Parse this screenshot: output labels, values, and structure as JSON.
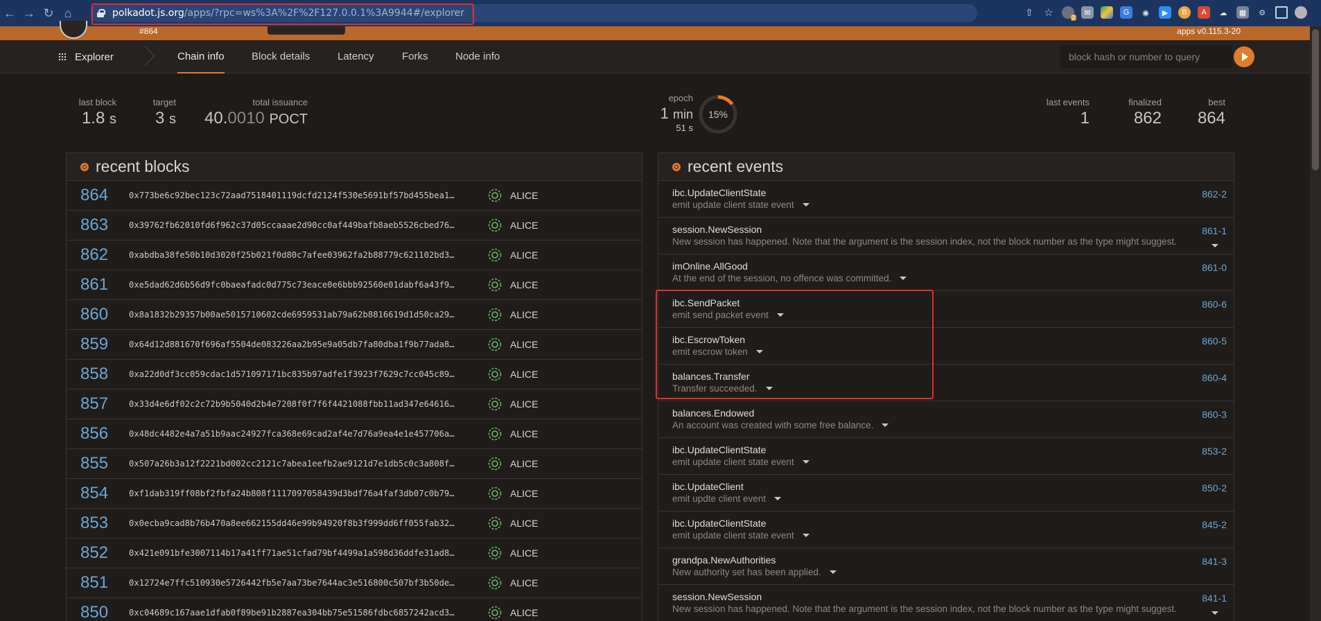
{
  "browser": {
    "url_host": "polkadot.js.org",
    "url_rest": "/apps/?rpc=ws%3A%2F%2F127.0.0.1%3A9944#/explorer",
    "ext_badge": "2"
  },
  "appbar": {
    "block_label": "#864",
    "version": "apps v0.115.3-20"
  },
  "tabs": {
    "root": "Explorer",
    "items": [
      "Chain info",
      "Block details",
      "Latency",
      "Forks",
      "Node info"
    ],
    "query_placeholder": "block hash or number to query"
  },
  "summary": {
    "last_block_label": "last block",
    "last_block_value": "1.8",
    "last_block_unit": "s",
    "target_label": "target",
    "target_value": "3",
    "target_unit": "s",
    "issuance_label": "total issuance",
    "issuance_int": "40.",
    "issuance_frac": "0010",
    "issuance_unit": "POCT",
    "epoch_label": "epoch",
    "epoch_min": "1",
    "epoch_min_unit": "min",
    "epoch_sec": "51",
    "epoch_sec_unit": "s",
    "epoch_percent": "15%",
    "epoch_progress": 0.15,
    "last_events_label": "last events",
    "last_events_value": "1",
    "finalized_label": "finalized",
    "finalized_value": "862",
    "best_label": "best",
    "best_value": "864"
  },
  "recent_blocks": {
    "title": "recent blocks",
    "rows": [
      {
        "num": "864",
        "hash": "0x773be6c92bec123c72aad7518401119dcfd2124f530e5691bf57bd455bea1…",
        "author": "ALICE"
      },
      {
        "num": "863",
        "hash": "0x39762fb62010fd6f962c37d05ccaaae2d90cc0af449bafb8aeb5526cbed76…",
        "author": "ALICE"
      },
      {
        "num": "862",
        "hash": "0xabdba38fe50b10d3020f25b021f0d80c7afee03962fa2b88779c621102bd3…",
        "author": "ALICE"
      },
      {
        "num": "861",
        "hash": "0xe5dad62d6b56d9fc0baeafadc0d775c73eace0e6bbb92560e01dabf6a43f9…",
        "author": "ALICE"
      },
      {
        "num": "860",
        "hash": "0x8a1832b29357b00ae5015710602cde6959531ab79a62b8816619d1d50ca29…",
        "author": "ALICE"
      },
      {
        "num": "859",
        "hash": "0x64d12d881670f696af5504de083226aa2b95e9a05db7fa80dba1f9b77ada8…",
        "author": "ALICE"
      },
      {
        "num": "858",
        "hash": "0xa22d0df3cc059cdac1d571097171bc835b97adfe1f3923f7629c7cc045c89…",
        "author": "ALICE"
      },
      {
        "num": "857",
        "hash": "0x33d4e6df02c2c72b9b5040d2b4e7208f0f7f6f4421088fbb11ad347e64616…",
        "author": "ALICE"
      },
      {
        "num": "856",
        "hash": "0x48dc4482e4a7a51b9aac24927fca368e69cad2af4e7d76a9ea4e1e457706a…",
        "author": "ALICE"
      },
      {
        "num": "855",
        "hash": "0x507a26b3a12f2221bd002cc2121c7abea1eefb2ae9121d7e1db5c0c3a808f…",
        "author": "ALICE"
      },
      {
        "num": "854",
        "hash": "0xf1dab319ff08bf2fbfa24b808f1117097058439d3bdf76a4faf3db07c0b79…",
        "author": "ALICE"
      },
      {
        "num": "853",
        "hash": "0x0ecba9cad8b76b470a8ee662155dd46e99b94920f8b3f999dd6ff055fab32…",
        "author": "ALICE"
      },
      {
        "num": "852",
        "hash": "0x421e091bfe3007114b17a41ff71ae51cfad79bf4499a1a598d36ddfe31ad8…",
        "author": "ALICE"
      },
      {
        "num": "851",
        "hash": "0x12724e7ffc510930e5726442fb5e7aa73be7644ac3e516800c507bf3b50de…",
        "author": "ALICE"
      },
      {
        "num": "850",
        "hash": "0xc04689c167aae1dfab0f89be91b2887ea304bb75e51586fdbc6857242acd3…",
        "author": "ALICE"
      }
    ]
  },
  "recent_events": {
    "title": "recent events",
    "rows": [
      {
        "name": "ibc.UpdateClientState",
        "desc": "emit update client state event",
        "id": "862-2"
      },
      {
        "name": "session.NewSession",
        "desc": "New session has happened. Note that the argument is the session index, not the block number as the type might suggest.",
        "id": "861-1"
      },
      {
        "name": "imOnline.AllGood",
        "desc": "At the end of the session, no offence was committed.",
        "id": "861-0"
      },
      {
        "name": "ibc.SendPacket",
        "desc": "emit send packet event",
        "id": "860-6"
      },
      {
        "name": "ibc.EscrowToken",
        "desc": "emit escrow token",
        "id": "860-5"
      },
      {
        "name": "balances.Transfer",
        "desc": "Transfer succeeded.",
        "id": "860-4"
      },
      {
        "name": "balances.Endowed",
        "desc": "An account was created with some free balance.",
        "id": "860-3"
      },
      {
        "name": "ibc.UpdateClientState",
        "desc": "emit update client state event",
        "id": "853-2"
      },
      {
        "name": "ibc.UpdateClient",
        "desc": "emit updte client event",
        "id": "850-2"
      },
      {
        "name": "ibc.UpdateClientState",
        "desc": "emit update client state event",
        "id": "845-2"
      },
      {
        "name": "grandpa.NewAuthorities",
        "desc": "New authority set has been applied.",
        "id": "841-3"
      },
      {
        "name": "session.NewSession",
        "desc": "New session has happened. Note that the argument is the session index, not the block number as the type might suggest.",
        "id": "841-1"
      }
    ]
  }
}
